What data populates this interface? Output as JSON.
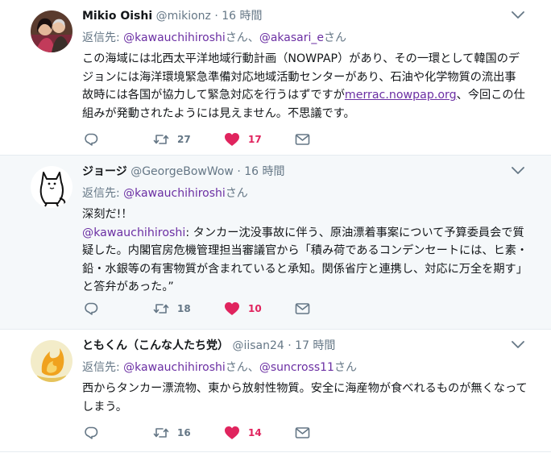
{
  "tweets": [
    {
      "name": "Mikio Oishi",
      "handle": "@mikionz",
      "sep": "·",
      "time": "16 時間",
      "reply_prefix": "返信先: ",
      "reply_mentions": [
        "@kawauchihiroshi",
        "@akasari_e"
      ],
      "reply_suffixes": [
        "さん、",
        "さん"
      ],
      "text_lines": [
        "この海域には北西太平洋地域行動計画（NOWPAP）があり、その一環として韓国のデ",
        "ジョンには海洋環境緊急準備対応地域活動センターがあり、石油や化学物質の流出事",
        "故時には各国が協力して緊急対応を行うはずですが",
        "組みが発動されたようには見えません。不思議です。"
      ],
      "link": "merrac.nowpap.org",
      "link_after": "、今回この仕",
      "retweets": "27",
      "likes": "17",
      "like_color": "#e0245e"
    },
    {
      "name": "ジョージ",
      "handle": "@GeorgeBowWow",
      "sep": "·",
      "time": "16 時間",
      "reply_prefix": "返信先: ",
      "reply_mentions": [
        "@kawauchihiroshi"
      ],
      "reply_suffixes": [
        "さん"
      ],
      "text_first": "深刻だ!！",
      "mention": "@kawauchihiroshi",
      "text_lines": [
        ": タンカー沈没事故に伴う、原油漂着事案について予算委員会で質",
        "疑した。内閣官房危機管理担当審議官から「積み荷であるコンデンセートには、ヒ素・",
        "鉛・水銀等の有害物質が含まれていると承知。関係省庁と連携し、対応に万全を期す」",
        "と答弁があった。”"
      ],
      "retweets": "18",
      "likes": "10"
    },
    {
      "name": "ともくん（こんな人たち党）",
      "handle": "@iisan24",
      "sep": "·",
      "time": "17 時間",
      "reply_prefix": "返信先: ",
      "reply_mentions": [
        "@kawauchihiroshi",
        "@suncross11"
      ],
      "reply_suffixes": [
        "さん、",
        "さん"
      ],
      "text_lines": [
        "西からタンカー漂流物、東から放射性物質。安全に海産物が食べれるものが無くなって",
        "しまう。"
      ],
      "retweets": "16",
      "likes": "14"
    }
  ],
  "icons": {
    "reply": "reply-icon",
    "retweet": "retweet-icon",
    "like": "heart-icon",
    "dm": "envelope-icon",
    "caret": "chevron-down-icon"
  },
  "colors": {
    "mention": "#6b2fa3",
    "muted": "#657786",
    "like": "#e0245e",
    "border": "#e6ecf0",
    "highlight_bg": "#f5f8fa"
  }
}
